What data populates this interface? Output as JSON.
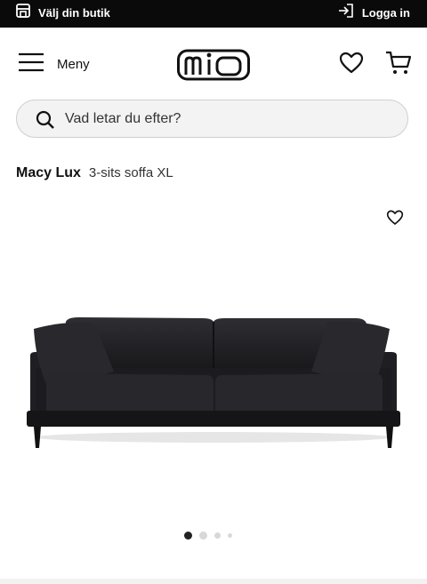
{
  "topbar": {
    "store_label": "Välj din butik",
    "login_label": "Logga in"
  },
  "header": {
    "menu_label": "Meny",
    "logo_text": "mio"
  },
  "search": {
    "placeholder": "Vad letar du efter?"
  },
  "product": {
    "name": "Macy Lux",
    "subtitle": "3-sits soffa XL",
    "image_icon": "sofa-product-image",
    "carousel": {
      "count": 4,
      "active_index": 0
    }
  },
  "colors": {
    "topbar_bg": "#0a0a0a",
    "sofa": "#222226",
    "search_bg": "#f3f3f3"
  }
}
